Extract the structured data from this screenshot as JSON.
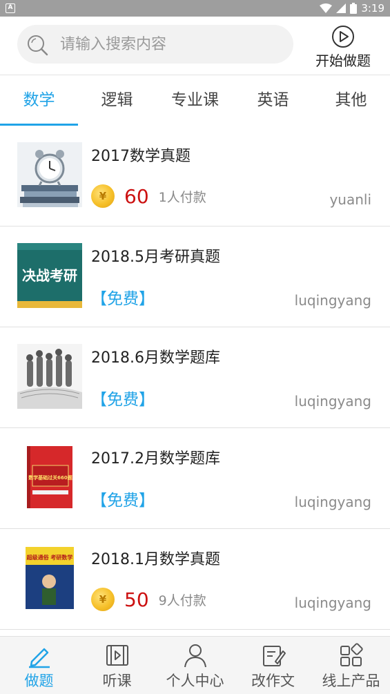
{
  "status_bar": {
    "notification_label": "A",
    "time": "3:19",
    "icons": [
      "wifi-icon",
      "signal-icon",
      "battery-icon"
    ]
  },
  "search": {
    "placeholder": "请输入搜索内容"
  },
  "start_button": {
    "label": "开始做题",
    "icon": "play-circle-icon"
  },
  "tabs": [
    {
      "label": "数学",
      "active": true
    },
    {
      "label": "逻辑"
    },
    {
      "label": "专业课"
    },
    {
      "label": "英语"
    },
    {
      "label": "其他"
    }
  ],
  "items": [
    {
      "title": "2017数学真题",
      "price": "60",
      "paid_count": "1人付款",
      "author": "yuanli",
      "coin_symbol": "¥",
      "thumb": "clock-on-books"
    },
    {
      "title": "2018.5月考研真题",
      "free_label": "【免费】",
      "author": "luqingyang",
      "thumb": "poster-juezhan-kaoyan",
      "thumb_text": "决战考研"
    },
    {
      "title": "2018.6月数学题库",
      "free_label": "【免费】",
      "author": "luqingyang",
      "thumb": "people-on-book"
    },
    {
      "title": "2017.2月数学题库",
      "free_label": "【免费】",
      "author": "luqingyang",
      "thumb": "red-book-660",
      "thumb_text": "数学基础过关660题"
    },
    {
      "title": "2018.1月数学真题",
      "price": "50",
      "paid_count": "9人付款",
      "author": "luqingyang",
      "coin_symbol": "¥",
      "thumb": "book-chaoji-tongsu",
      "thumb_text": "超级通俗 考研数学"
    }
  ],
  "bottom_nav": [
    {
      "label": "做题",
      "icon": "pencil-icon",
      "active": true
    },
    {
      "label": "听课",
      "icon": "video-icon"
    },
    {
      "label": "个人中心",
      "icon": "person-icon"
    },
    {
      "label": "改作文",
      "icon": "edit-document-icon"
    },
    {
      "label": "线上产品",
      "icon": "apps-grid-icon"
    }
  ],
  "colors": {
    "accent": "#20a3e7",
    "price_red": "#cc1111",
    "status_bar": "#9e9e9e"
  }
}
